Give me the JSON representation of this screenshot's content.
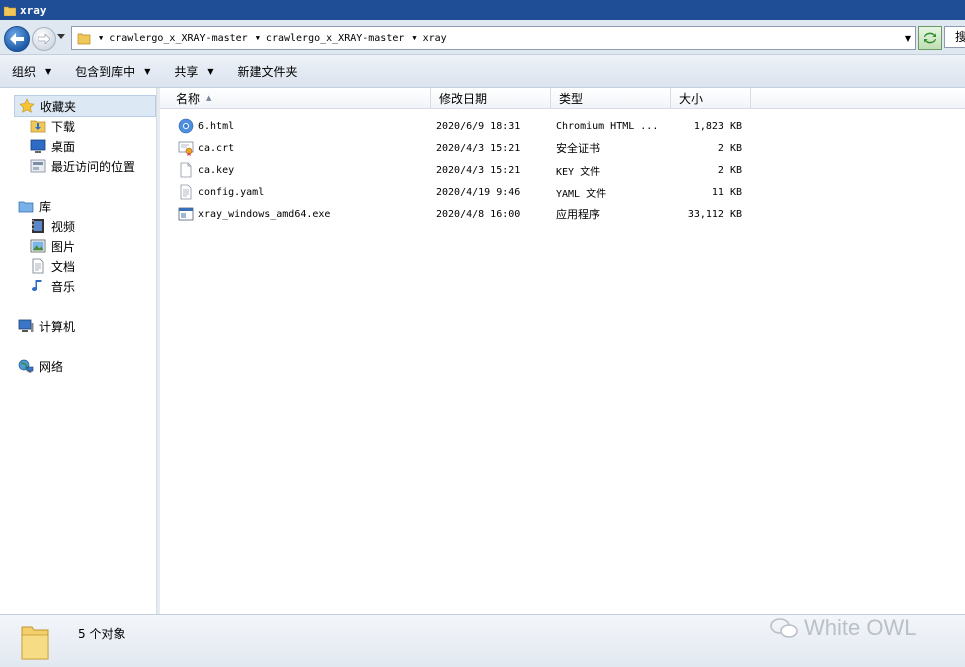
{
  "window": {
    "title": "xray"
  },
  "address": {
    "breadcrumbs": [
      "crawlergo_x_XRAY-master",
      "crawlergo_x_XRAY-master",
      "xray"
    ],
    "search_partial": "搜"
  },
  "toolbar": {
    "organize": "组织",
    "include_in_library": "包含到库中",
    "share": "共享",
    "new_folder": "新建文件夹"
  },
  "nav": {
    "favorites": "收藏夹",
    "downloads": "下载",
    "desktop": "桌面",
    "recent_places": "最近访问的位置",
    "libraries": "库",
    "videos": "视频",
    "pictures": "图片",
    "documents": "文档",
    "music": "音乐",
    "computer": "计算机",
    "network": "网络"
  },
  "columns": {
    "name": "名称",
    "date": "修改日期",
    "type": "类型",
    "size": "大小"
  },
  "files": [
    {
      "name": "6.html",
      "date": "2020/6/9 18:31",
      "type": "Chromium HTML ...",
      "size": "1,823 KB",
      "icon": "chromium-html-icon"
    },
    {
      "name": "ca.crt",
      "date": "2020/4/3 15:21",
      "type": "安全证书",
      "size": "2 KB",
      "icon": "certificate-icon"
    },
    {
      "name": "ca.key",
      "date": "2020/4/3 15:21",
      "type": "KEY 文件",
      "size": "2 KB",
      "icon": "blank-file-icon"
    },
    {
      "name": "config.yaml",
      "date": "2020/4/19 9:46",
      "type": "YAML 文件",
      "size": "11 KB",
      "icon": "text-file-icon"
    },
    {
      "name": "xray_windows_amd64.exe",
      "date": "2020/4/8 16:00",
      "type": "应用程序",
      "size": "33,112 KB",
      "icon": "exe-file-icon"
    }
  ],
  "status": {
    "count_text": "5 个对象"
  },
  "watermark": {
    "text": "White OWL"
  },
  "colors": {
    "titlebar": "#1f4e96",
    "selection": "#dde8f5",
    "accent": "#1e5aa8"
  }
}
